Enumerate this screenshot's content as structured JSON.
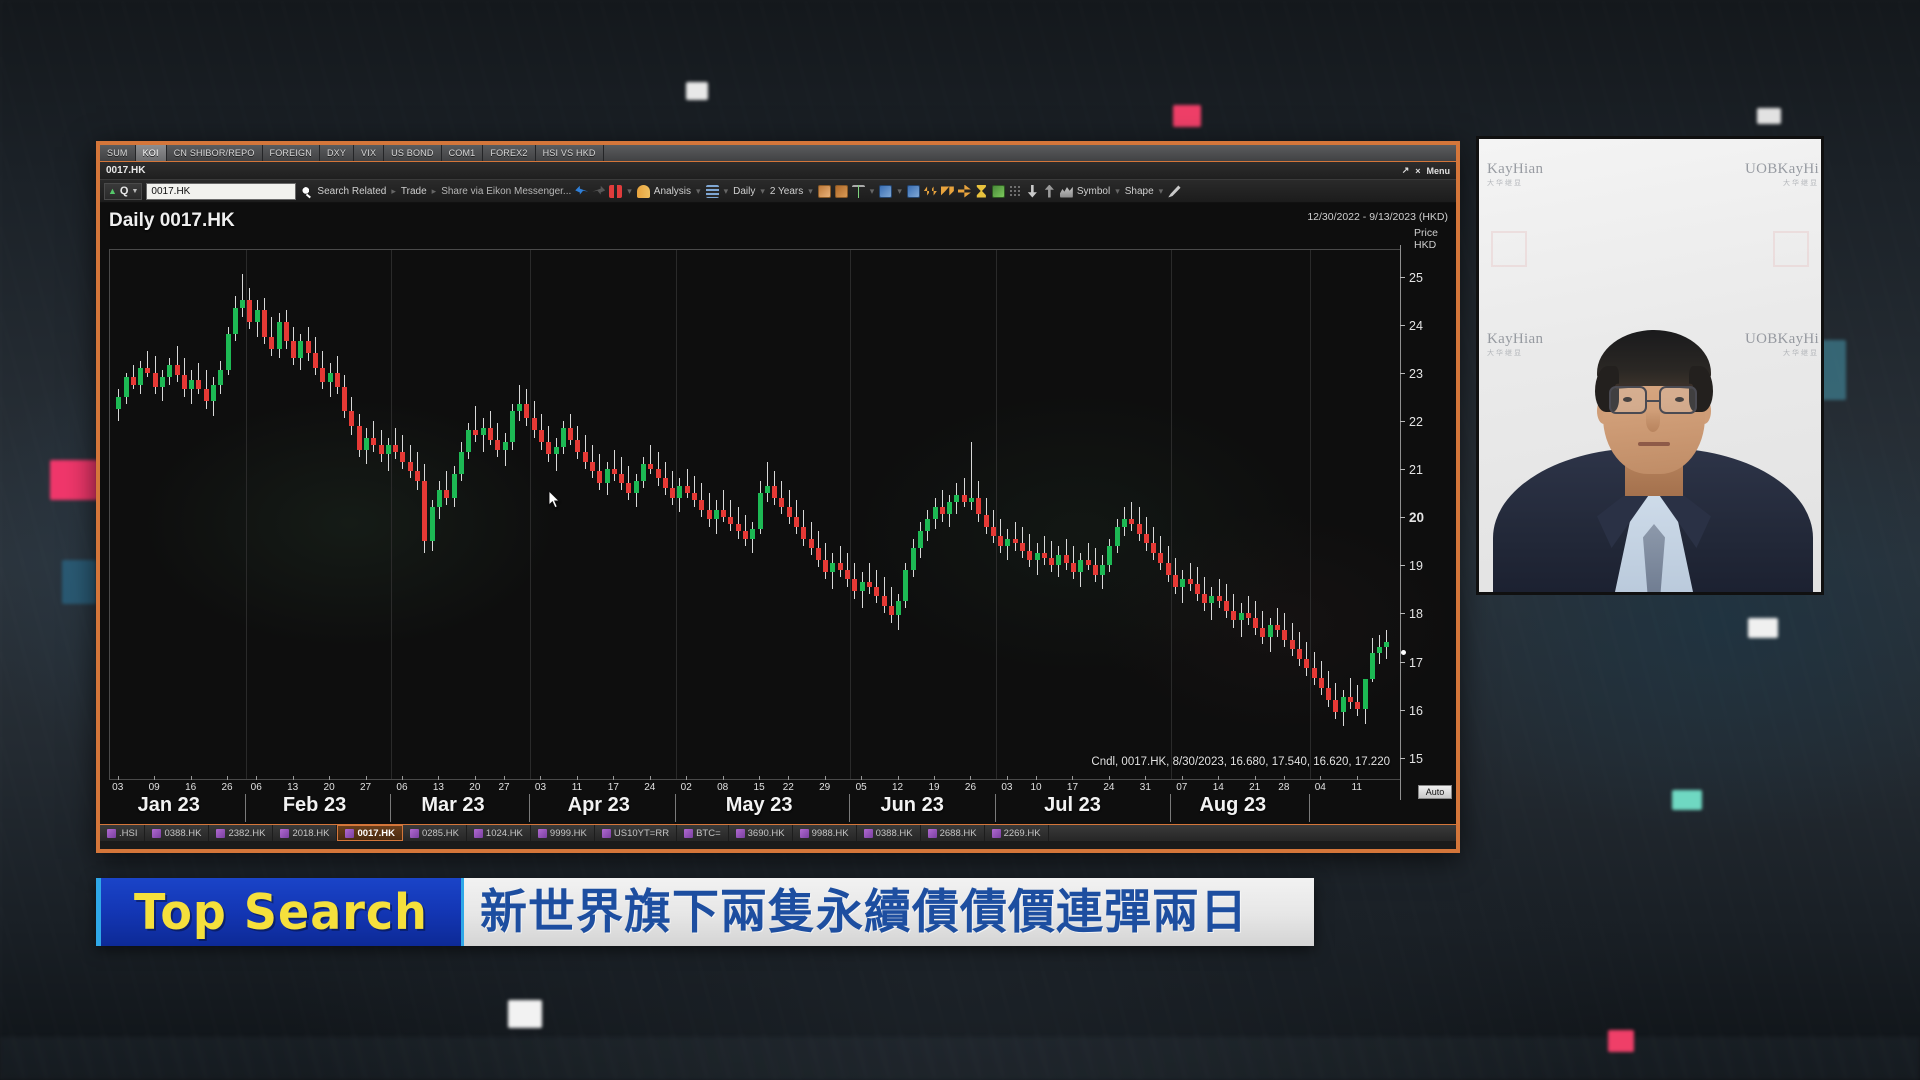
{
  "app": {
    "tabs": [
      {
        "label": "SUM",
        "active": false
      },
      {
        "label": "KOI",
        "active": true
      },
      {
        "label": "CN SHIBOR/REPO",
        "active": false
      },
      {
        "label": "FOREIGN",
        "active": false
      },
      {
        "label": "DXY",
        "active": false
      },
      {
        "label": "VIX",
        "active": false
      },
      {
        "label": "US BOND",
        "active": false
      },
      {
        "label": "COM1",
        "active": false
      },
      {
        "label": "FOREX2",
        "active": false
      },
      {
        "label": "HSI VS HKD",
        "active": false
      }
    ],
    "window_title": "0017.HK",
    "menu_label": "Menu",
    "accent_color": "#d4763a"
  },
  "toolbar": {
    "quote_badge": "Q",
    "symbol_value": "0017.HK",
    "symbol_placeholder": "0017.HK",
    "search_related": "Search Related",
    "trade": "Trade",
    "share": "Share via Eikon Messenger...",
    "analysis": "Analysis",
    "interval": "Daily",
    "range": "2 Years",
    "symbol_menu": "Symbol",
    "shape_menu": "Shape"
  },
  "chart": {
    "title": "Daily 0017.HK",
    "date_range": "12/30/2022 - 9/13/2023 (HKD)",
    "price_header_line1": "Price",
    "price_header_line2": "HKD",
    "ohlc_readout": "Cndl, 0017.HK, 8/30/2023, 16.680, 17.540, 16.620, 17.220",
    "auto_button": "Auto",
    "up_color": "#1db954",
    "down_color": "#e53935"
  },
  "chart_data": {
    "type": "candlestick",
    "title": "Daily 0017.HK",
    "subtitle": "12/30/2022 - 9/13/2023 (HKD)",
    "xlabel": "",
    "ylabel": "Price HKD",
    "ylim": [
      14.6,
      25.6
    ],
    "yticks": [
      25,
      24,
      23,
      22,
      21,
      20,
      19,
      18,
      17,
      16,
      15
    ],
    "ytick_bold": 20,
    "grid": true,
    "legend": "none",
    "last_price": 17.22,
    "months": [
      {
        "label": "Jan 23",
        "days": [
          "03",
          "09",
          "16",
          "26"
        ]
      },
      {
        "label": "Feb 23",
        "days": [
          "06",
          "13",
          "20",
          "27"
        ]
      },
      {
        "label": "Mar 23",
        "days": [
          "06",
          "13",
          "20",
          "27"
        ]
      },
      {
        "label": "Apr 23",
        "days": [
          "03",
          "11",
          "17",
          "24"
        ]
      },
      {
        "label": "May 23",
        "days": [
          "02",
          "08",
          "15",
          "22",
          "29"
        ]
      },
      {
        "label": "Jun 23",
        "days": [
          "05",
          "12",
          "19",
          "26"
        ]
      },
      {
        "label": "Jul 23",
        "days": [
          "03",
          "10",
          "17",
          "24",
          "31"
        ]
      },
      {
        "label": "Aug 23",
        "days": [
          "07",
          "14",
          "21",
          "28"
        ]
      },
      {
        "label": "",
        "days": [
          "04",
          "11"
        ]
      }
    ],
    "last_candle": {
      "date": "8/30/2023",
      "open": 16.68,
      "high": 17.54,
      "low": 16.62,
      "close": 17.22
    },
    "ohlc": [
      [
        22.3,
        22.7,
        22.05,
        22.55
      ],
      [
        22.55,
        23.05,
        22.4,
        22.95
      ],
      [
        22.95,
        23.2,
        22.7,
        22.8
      ],
      [
        22.8,
        23.3,
        22.6,
        23.15
      ],
      [
        23.15,
        23.5,
        22.95,
        23.05
      ],
      [
        23.05,
        23.4,
        22.6,
        22.75
      ],
      [
        22.75,
        23.1,
        22.45,
        22.95
      ],
      [
        22.95,
        23.35,
        22.8,
        23.2
      ],
      [
        23.2,
        23.6,
        22.85,
        23.0
      ],
      [
        23.0,
        23.35,
        22.55,
        22.7
      ],
      [
        22.7,
        23.1,
        22.4,
        22.9
      ],
      [
        22.9,
        23.25,
        22.6,
        22.7
      ],
      [
        22.7,
        23.1,
        22.3,
        22.45
      ],
      [
        22.45,
        22.95,
        22.15,
        22.8
      ],
      [
        22.8,
        23.3,
        22.6,
        23.1
      ],
      [
        23.1,
        24.0,
        23.0,
        23.85
      ],
      [
        23.85,
        24.65,
        23.7,
        24.4
      ],
      [
        24.4,
        25.1,
        24.2,
        24.55
      ],
      [
        24.55,
        24.8,
        23.95,
        24.1
      ],
      [
        24.1,
        24.55,
        23.8,
        24.35
      ],
      [
        24.35,
        24.6,
        23.65,
        23.8
      ],
      [
        23.8,
        24.2,
        23.4,
        23.55
      ],
      [
        23.55,
        24.3,
        23.35,
        24.1
      ],
      [
        24.1,
        24.35,
        23.55,
        23.7
      ],
      [
        23.7,
        24.0,
        23.2,
        23.35
      ],
      [
        23.35,
        23.85,
        23.1,
        23.7
      ],
      [
        23.7,
        24.0,
        23.3,
        23.45
      ],
      [
        23.45,
        23.8,
        23.0,
        23.15
      ],
      [
        23.15,
        23.5,
        22.7,
        22.85
      ],
      [
        22.85,
        23.25,
        22.55,
        23.05
      ],
      [
        23.05,
        23.4,
        22.6,
        22.75
      ],
      [
        22.75,
        23.0,
        22.1,
        22.25
      ],
      [
        22.25,
        22.55,
        21.75,
        21.95
      ],
      [
        21.95,
        22.2,
        21.3,
        21.45
      ],
      [
        21.45,
        21.9,
        21.15,
        21.7
      ],
      [
        21.7,
        22.05,
        21.4,
        21.55
      ],
      [
        21.55,
        21.85,
        21.2,
        21.35
      ],
      [
        21.35,
        21.7,
        21.0,
        21.55
      ],
      [
        21.55,
        21.9,
        21.25,
        21.4
      ],
      [
        21.4,
        21.75,
        21.05,
        21.2
      ],
      [
        21.2,
        21.55,
        20.85,
        21.0
      ],
      [
        21.0,
        21.4,
        20.6,
        20.8
      ],
      [
        20.8,
        21.15,
        19.3,
        19.55
      ],
      [
        19.55,
        20.4,
        19.35,
        20.25
      ],
      [
        20.25,
        20.8,
        20.0,
        20.6
      ],
      [
        20.6,
        21.0,
        20.3,
        20.45
      ],
      [
        20.45,
        21.1,
        20.25,
        20.95
      ],
      [
        20.95,
        21.6,
        20.8,
        21.4
      ],
      [
        21.4,
        22.0,
        21.25,
        21.85
      ],
      [
        21.85,
        22.35,
        21.6,
        21.75
      ],
      [
        21.75,
        22.1,
        21.4,
        21.9
      ],
      [
        21.9,
        22.25,
        21.55,
        21.65
      ],
      [
        21.65,
        22.0,
        21.3,
        21.45
      ],
      [
        21.45,
        21.8,
        21.1,
        21.6
      ],
      [
        21.6,
        22.4,
        21.45,
        22.25
      ],
      [
        22.25,
        22.8,
        22.05,
        22.4
      ],
      [
        22.4,
        22.7,
        21.95,
        22.1
      ],
      [
        22.1,
        22.45,
        21.7,
        21.85
      ],
      [
        21.85,
        22.2,
        21.45,
        21.6
      ],
      [
        21.6,
        21.95,
        21.2,
        21.35
      ],
      [
        21.35,
        21.7,
        21.0,
        21.5
      ],
      [
        21.5,
        22.05,
        21.35,
        21.9
      ],
      [
        21.9,
        22.2,
        21.55,
        21.65
      ],
      [
        21.65,
        21.95,
        21.25,
        21.4
      ],
      [
        21.4,
        21.75,
        21.05,
        21.2
      ],
      [
        21.2,
        21.55,
        20.85,
        21.0
      ],
      [
        21.0,
        21.35,
        20.6,
        20.75
      ],
      [
        20.75,
        21.2,
        20.5,
        21.05
      ],
      [
        21.05,
        21.45,
        20.8,
        20.95
      ],
      [
        20.95,
        21.3,
        20.6,
        20.75
      ],
      [
        20.75,
        21.1,
        20.4,
        20.55
      ],
      [
        20.55,
        20.95,
        20.25,
        20.8
      ],
      [
        20.8,
        21.3,
        20.65,
        21.15
      ],
      [
        21.15,
        21.55,
        20.95,
        21.05
      ],
      [
        21.05,
        21.4,
        20.7,
        20.85
      ],
      [
        20.85,
        21.2,
        20.5,
        20.65
      ],
      [
        20.65,
        21.0,
        20.3,
        20.45
      ],
      [
        20.45,
        20.85,
        20.15,
        20.7
      ],
      [
        20.7,
        21.05,
        20.45,
        20.55
      ],
      [
        20.55,
        20.9,
        20.25,
        20.4
      ],
      [
        20.4,
        20.75,
        20.05,
        20.2
      ],
      [
        20.2,
        20.55,
        19.85,
        20.0
      ],
      [
        20.0,
        20.4,
        19.7,
        20.2
      ],
      [
        20.2,
        20.6,
        19.95,
        20.05
      ],
      [
        20.05,
        20.4,
        19.75,
        19.9
      ],
      [
        19.9,
        20.25,
        19.6,
        19.75
      ],
      [
        19.75,
        20.1,
        19.45,
        19.6
      ],
      [
        19.6,
        19.95,
        19.3,
        19.8
      ],
      [
        19.8,
        20.8,
        19.7,
        20.55
      ],
      [
        20.55,
        21.2,
        20.35,
        20.7
      ],
      [
        20.7,
        21.0,
        20.3,
        20.45
      ],
      [
        20.45,
        20.8,
        20.1,
        20.25
      ],
      [
        20.25,
        20.6,
        19.9,
        20.05
      ],
      [
        20.05,
        20.4,
        19.7,
        19.85
      ],
      [
        19.85,
        20.2,
        19.45,
        19.6
      ],
      [
        19.6,
        19.95,
        19.25,
        19.4
      ],
      [
        19.4,
        19.75,
        19.0,
        19.15
      ],
      [
        19.15,
        19.5,
        18.75,
        18.9
      ],
      [
        18.9,
        19.3,
        18.55,
        19.1
      ],
      [
        19.1,
        19.45,
        18.8,
        18.95
      ],
      [
        18.95,
        19.3,
        18.6,
        18.75
      ],
      [
        18.75,
        19.1,
        18.35,
        18.5
      ],
      [
        18.5,
        18.9,
        18.15,
        18.7
      ],
      [
        18.7,
        19.1,
        18.45,
        18.6
      ],
      [
        18.6,
        18.95,
        18.25,
        18.4
      ],
      [
        18.4,
        18.8,
        18.05,
        18.2
      ],
      [
        18.2,
        18.6,
        17.85,
        18.0
      ],
      [
        18.0,
        18.45,
        17.7,
        18.3
      ],
      [
        18.3,
        19.1,
        18.15,
        18.95
      ],
      [
        18.95,
        19.6,
        18.8,
        19.4
      ],
      [
        19.4,
        19.95,
        19.2,
        19.75
      ],
      [
        19.75,
        20.2,
        19.55,
        20.0
      ],
      [
        20.0,
        20.45,
        19.8,
        20.25
      ],
      [
        20.25,
        20.6,
        19.95,
        20.1
      ],
      [
        20.1,
        20.5,
        19.85,
        20.35
      ],
      [
        20.35,
        20.75,
        20.1,
        20.5
      ],
      [
        20.5,
        20.85,
        20.25,
        20.35
      ],
      [
        20.35,
        21.6,
        20.2,
        20.45
      ],
      [
        20.45,
        20.8,
        19.95,
        20.1
      ],
      [
        20.1,
        20.45,
        19.7,
        19.85
      ],
      [
        19.85,
        20.2,
        19.5,
        19.65
      ],
      [
        19.65,
        20.0,
        19.3,
        19.45
      ],
      [
        19.45,
        19.8,
        19.15,
        19.6
      ],
      [
        19.6,
        19.95,
        19.35,
        19.5
      ],
      [
        19.5,
        19.85,
        19.2,
        19.35
      ],
      [
        19.35,
        19.7,
        19.0,
        19.15
      ],
      [
        19.15,
        19.5,
        18.85,
        19.3
      ],
      [
        19.3,
        19.65,
        19.05,
        19.2
      ],
      [
        19.2,
        19.55,
        18.9,
        19.05
      ],
      [
        19.05,
        19.45,
        18.8,
        19.25
      ],
      [
        19.25,
        19.6,
        18.95,
        19.1
      ],
      [
        19.1,
        19.45,
        18.75,
        18.9
      ],
      [
        18.9,
        19.3,
        18.6,
        19.15
      ],
      [
        19.15,
        19.5,
        18.95,
        19.05
      ],
      [
        19.05,
        19.4,
        18.7,
        18.85
      ],
      [
        18.85,
        19.25,
        18.55,
        19.05
      ],
      [
        19.05,
        19.6,
        18.9,
        19.45
      ],
      [
        19.45,
        20.0,
        19.3,
        19.85
      ],
      [
        19.85,
        20.25,
        19.65,
        20.0
      ],
      [
        20.0,
        20.35,
        19.75,
        19.9
      ],
      [
        19.9,
        20.25,
        19.55,
        19.7
      ],
      [
        19.7,
        20.05,
        19.35,
        19.5
      ],
      [
        19.5,
        19.85,
        19.15,
        19.3
      ],
      [
        19.3,
        19.65,
        18.95,
        19.1
      ],
      [
        19.1,
        19.45,
        18.7,
        18.85
      ],
      [
        18.85,
        19.2,
        18.45,
        18.6
      ],
      [
        18.6,
        18.95,
        18.25,
        18.75
      ],
      [
        18.75,
        19.1,
        18.5,
        18.65
      ],
      [
        18.65,
        19.0,
        18.3,
        18.45
      ],
      [
        18.45,
        18.8,
        18.1,
        18.25
      ],
      [
        18.25,
        18.6,
        17.9,
        18.4
      ],
      [
        18.4,
        18.75,
        18.15,
        18.3
      ],
      [
        18.3,
        18.65,
        17.95,
        18.1
      ],
      [
        18.1,
        18.45,
        17.75,
        17.9
      ],
      [
        17.9,
        18.25,
        17.55,
        18.05
      ],
      [
        18.05,
        18.4,
        17.8,
        17.95
      ],
      [
        17.95,
        18.3,
        17.6,
        17.75
      ],
      [
        17.75,
        18.1,
        17.4,
        17.55
      ],
      [
        17.55,
        17.95,
        17.25,
        17.8
      ],
      [
        17.8,
        18.15,
        17.55,
        17.7
      ],
      [
        17.7,
        18.05,
        17.35,
        17.5
      ],
      [
        17.5,
        17.85,
        17.15,
        17.3
      ],
      [
        17.3,
        17.65,
        16.95,
        17.1
      ],
      [
        17.1,
        17.45,
        16.75,
        16.9
      ],
      [
        16.9,
        17.25,
        16.55,
        16.7
      ],
      [
        16.7,
        17.05,
        16.35,
        16.5
      ],
      [
        16.5,
        16.85,
        16.1,
        16.25
      ],
      [
        16.25,
        16.6,
        15.85,
        16.0
      ],
      [
        16.0,
        16.45,
        15.7,
        16.3
      ],
      [
        16.3,
        16.7,
        16.05,
        16.2
      ],
      [
        16.2,
        16.55,
        15.9,
        16.05
      ],
      [
        16.05,
        16.4,
        15.75,
        16.68
      ],
      [
        16.68,
        17.54,
        16.62,
        17.22
      ],
      [
        17.22,
        17.6,
        17.0,
        17.35
      ],
      [
        17.35,
        17.7,
        17.1,
        17.45
      ]
    ]
  },
  "ticker": {
    "items": [
      {
        "label": ".HSI",
        "active": false
      },
      {
        "label": "0388.HK",
        "active": false
      },
      {
        "label": "2382.HK",
        "active": false
      },
      {
        "label": "2018.HK",
        "active": false
      },
      {
        "label": "0017.HK",
        "active": true
      },
      {
        "label": "0285.HK",
        "active": false
      },
      {
        "label": "1024.HK",
        "active": false
      },
      {
        "label": "9999.HK",
        "active": false
      },
      {
        "label": "US10YT=RR",
        "active": false
      },
      {
        "label": "BTC=",
        "active": false
      },
      {
        "label": "3690.HK",
        "active": false
      },
      {
        "label": "9988.HK",
        "active": false
      },
      {
        "label": "0388.HK",
        "active": false
      },
      {
        "label": "2688.HK",
        "active": false
      },
      {
        "label": "2269.HK",
        "active": false
      }
    ]
  },
  "video": {
    "watermark_left": "KayHian",
    "watermark_left_sub": "大华继显",
    "watermark_right": "UOBKayHi",
    "watermark_right_sub": "大华继显"
  },
  "banner": {
    "left_label": "Top Search",
    "headline": "新世界旗下兩隻永續債債價連彈兩日",
    "accent_blue": "#1a44c8",
    "accent_yellow": "#f5e03c",
    "headline_color": "#1d4ea0"
  }
}
